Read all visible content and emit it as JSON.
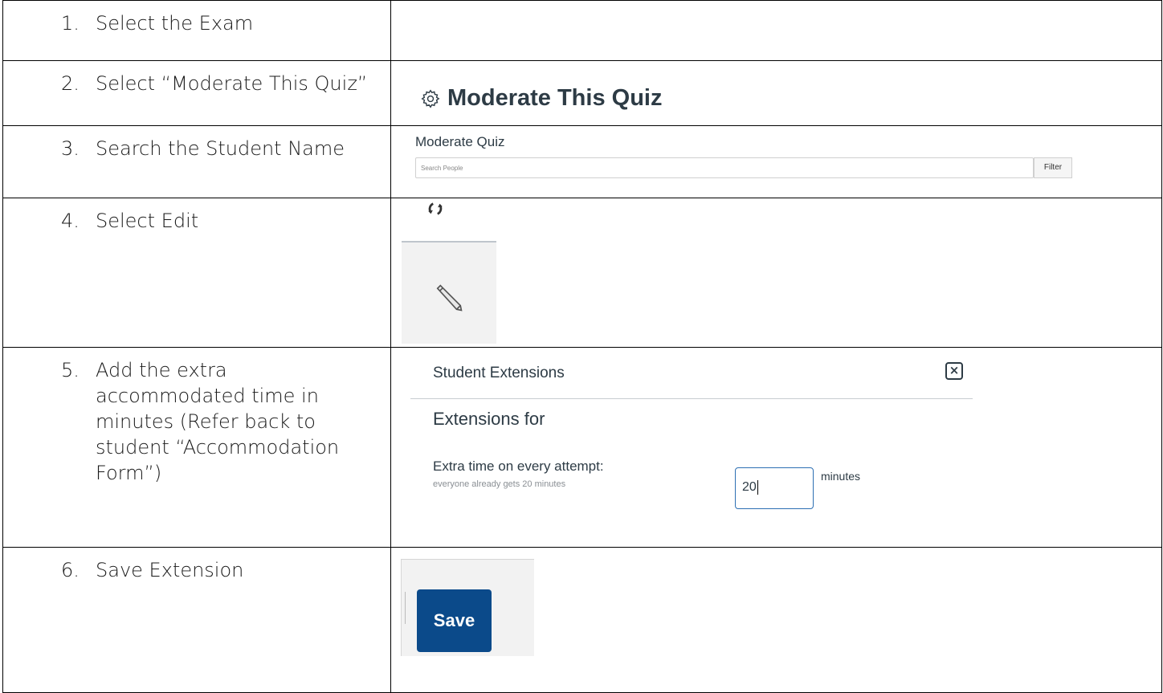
{
  "steps": [
    {
      "num": "1.",
      "text": "Select the Exam"
    },
    {
      "num": "2.",
      "text": "Select “Moderate This Quiz”"
    },
    {
      "num": "3.",
      "text": "Search the Student Name"
    },
    {
      "num": "4.",
      "text": "Select Edit"
    },
    {
      "num": "5.",
      "text": "Add the extra accommodated time in minutes (Refer back to student “Accommodation Form”)"
    },
    {
      "num": "6.",
      "text": "Save Extension"
    }
  ],
  "moderate": {
    "heading": "Moderate This Quiz",
    "icon": "gear-icon"
  },
  "moderate_quiz": {
    "label": "Moderate Quiz",
    "search_placeholder": "Search People",
    "filter_label": "Filter"
  },
  "edit": {
    "refresh_icon": "refresh-icon",
    "edit_icon": "pencil-icon"
  },
  "extensions": {
    "title": "Student Extensions",
    "close_label": "×",
    "extensions_for": "Extensions for",
    "extra_time_label": "Extra time on every attempt:",
    "extra_time_sub": "everyone already gets 20 minutes",
    "minutes_value": "20",
    "minutes_unit": "minutes"
  },
  "save": {
    "label": "Save"
  },
  "colors": {
    "save_blue": "#0b4a8a",
    "input_border": "#2d6fb3",
    "text_dark": "#2d3b45"
  }
}
